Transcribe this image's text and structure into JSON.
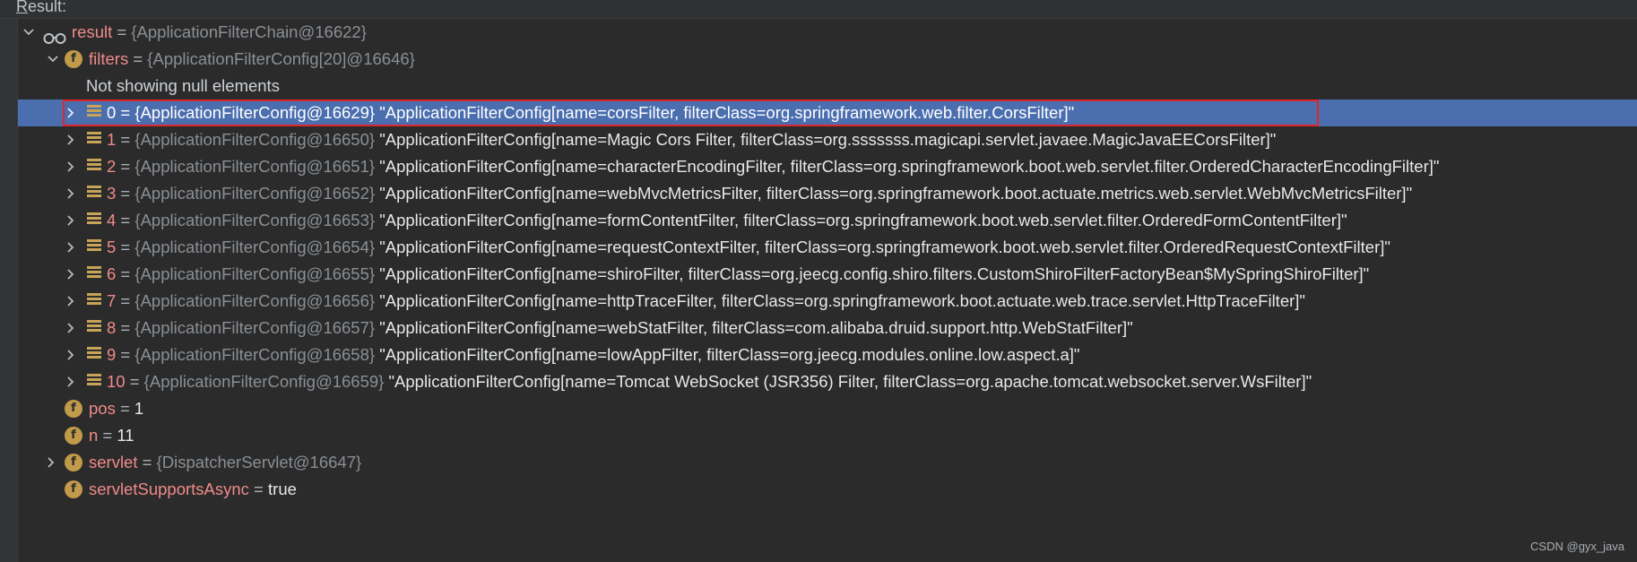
{
  "panel": {
    "result_label_mnemonic": "R",
    "result_label_rest": "esult:"
  },
  "tree": {
    "result": {
      "name": "result",
      "eq": " = ",
      "type": "{ApplicationFilterChain@16622}"
    },
    "filters": {
      "name": "filters",
      "eq": " = ",
      "type": "{ApplicationFilterConfig[20]@16646}",
      "info": "Not showing null elements",
      "items": [
        {
          "index": "0",
          "eq": " = ",
          "type": "{ApplicationFilterConfig@16629}",
          "value": "\"ApplicationFilterConfig[name=corsFilter, filterClass=org.springframework.web.filter.CorsFilter]\""
        },
        {
          "index": "1",
          "eq": " = ",
          "type": "{ApplicationFilterConfig@16650}",
          "value": "\"ApplicationFilterConfig[name=Magic Cors Filter, filterClass=org.sssssss.magicapi.servlet.javaee.MagicJavaEECorsFilter]\""
        },
        {
          "index": "2",
          "eq": " = ",
          "type": "{ApplicationFilterConfig@16651}",
          "value": "\"ApplicationFilterConfig[name=characterEncodingFilter, filterClass=org.springframework.boot.web.servlet.filter.OrderedCharacterEncodingFilter]\""
        },
        {
          "index": "3",
          "eq": " = ",
          "type": "{ApplicationFilterConfig@16652}",
          "value": "\"ApplicationFilterConfig[name=webMvcMetricsFilter, filterClass=org.springframework.boot.actuate.metrics.web.servlet.WebMvcMetricsFilter]\""
        },
        {
          "index": "4",
          "eq": " = ",
          "type": "{ApplicationFilterConfig@16653}",
          "value": "\"ApplicationFilterConfig[name=formContentFilter, filterClass=org.springframework.boot.web.servlet.filter.OrderedFormContentFilter]\""
        },
        {
          "index": "5",
          "eq": " = ",
          "type": "{ApplicationFilterConfig@16654}",
          "value": "\"ApplicationFilterConfig[name=requestContextFilter, filterClass=org.springframework.boot.web.servlet.filter.OrderedRequestContextFilter]\""
        },
        {
          "index": "6",
          "eq": " = ",
          "type": "{ApplicationFilterConfig@16655}",
          "value": "\"ApplicationFilterConfig[name=shiroFilter, filterClass=org.jeecg.config.shiro.filters.CustomShiroFilterFactoryBean$MySpringShiroFilter]\""
        },
        {
          "index": "7",
          "eq": " = ",
          "type": "{ApplicationFilterConfig@16656}",
          "value": "\"ApplicationFilterConfig[name=httpTraceFilter, filterClass=org.springframework.boot.actuate.web.trace.servlet.HttpTraceFilter]\""
        },
        {
          "index": "8",
          "eq": " = ",
          "type": "{ApplicationFilterConfig@16657}",
          "value": "\"ApplicationFilterConfig[name=webStatFilter, filterClass=com.alibaba.druid.support.http.WebStatFilter]\""
        },
        {
          "index": "9",
          "eq": " = ",
          "type": "{ApplicationFilterConfig@16658}",
          "value": "\"ApplicationFilterConfig[name=lowAppFilter, filterClass=org.jeecg.modules.online.low.aspect.a]\""
        },
        {
          "index": "10",
          "eq": " = ",
          "type": "{ApplicationFilterConfig@16659}",
          "value": "\"ApplicationFilterConfig[name=Tomcat WebSocket (JSR356) Filter, filterClass=org.apache.tomcat.websocket.server.WsFilter]\""
        }
      ]
    },
    "pos": {
      "name": "pos",
      "eq": " = ",
      "value": "1"
    },
    "n": {
      "name": "n",
      "eq": " = ",
      "value": "11"
    },
    "servlet": {
      "name": "servlet",
      "eq": " = ",
      "type": "{DispatcherServlet@16647}"
    },
    "servletSupportsAsync": {
      "name": "servletSupportsAsync",
      "eq": " = ",
      "value": "true"
    }
  },
  "icons": {
    "field": "f",
    "result_icon": "watch-glasses-icon",
    "array_element_icon": "array-element-icon"
  },
  "colors": {
    "background": "#2b2b2b",
    "selection": "#4b6eaf",
    "highlight_box": "#e0252b",
    "field_icon": "#c19a4a",
    "name": "#f08a8a"
  },
  "watermark": "CSDN @gyx_java"
}
